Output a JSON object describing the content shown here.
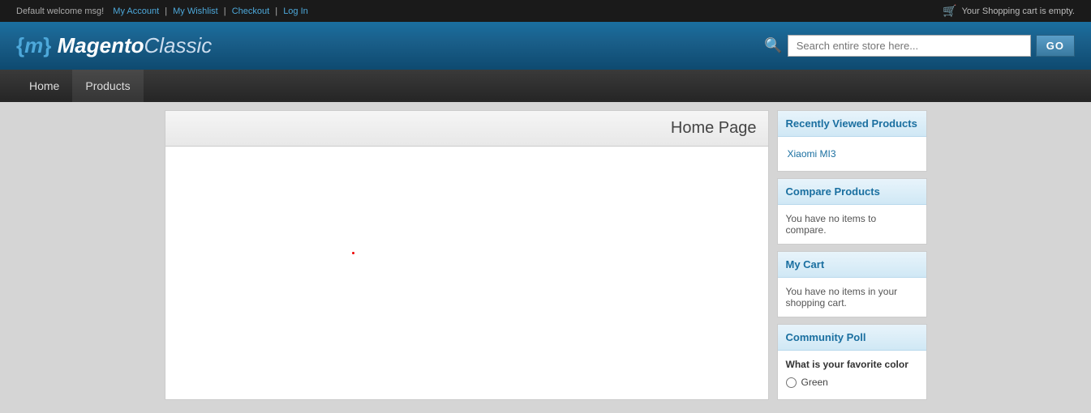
{
  "topbar": {
    "welcome": "Default welcome msg!",
    "my_account": "My Account",
    "my_wishlist": "My Wishlist",
    "checkout": "Checkout",
    "log_in": "Log In",
    "cart_status": "Your Shopping cart is empty."
  },
  "header": {
    "logo": "{m} MagentoClassic",
    "search_placeholder": "Search entire store here...",
    "search_button": "GO"
  },
  "nav": {
    "items": [
      {
        "label": "Home",
        "active": false
      },
      {
        "label": "Products",
        "active": true
      }
    ]
  },
  "content": {
    "title": "Home Page"
  },
  "sidebar": {
    "recently_viewed": {
      "title": "Recently Viewed Products",
      "items": [
        {
          "label": "Xiaomi MI3"
        }
      ]
    },
    "compare_products": {
      "title": "Compare Products",
      "empty_msg": "You have no items to compare."
    },
    "my_cart": {
      "title": "My Cart",
      "empty_msg": "You have no items in your shopping cart."
    },
    "community_poll": {
      "title": "Community Poll",
      "question": "What is your favorite color",
      "options": [
        {
          "label": "Green"
        }
      ]
    }
  }
}
